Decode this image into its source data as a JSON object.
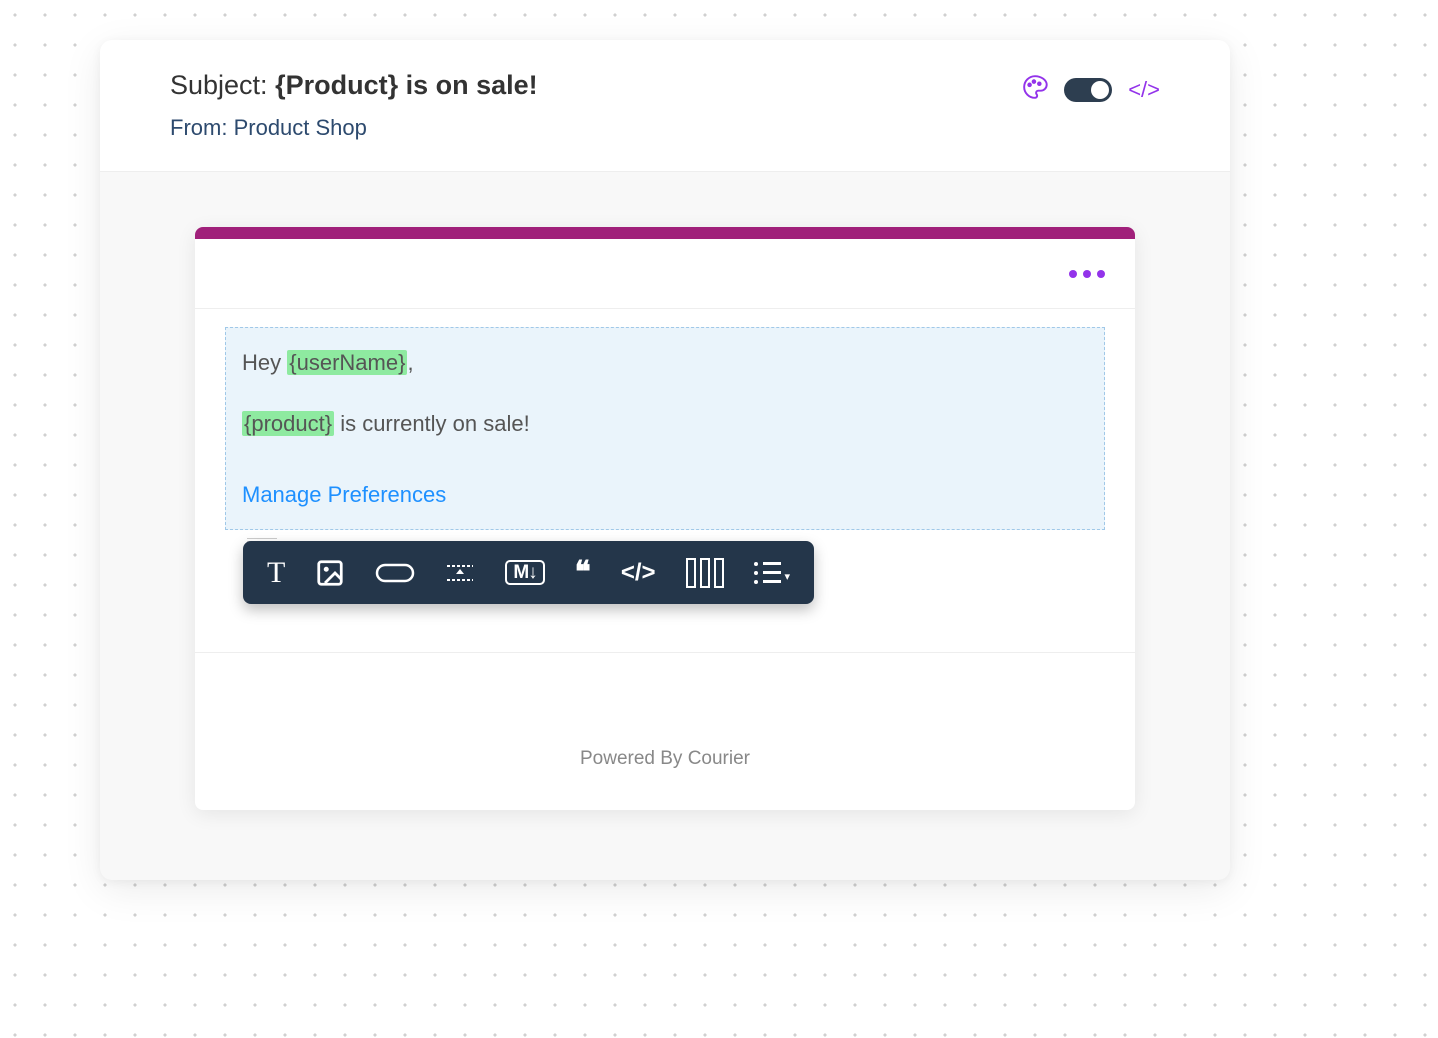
{
  "header": {
    "subject_label": "Subject:",
    "subject_value": "{Product} is on sale!",
    "from_label": "From:",
    "from_value": "Product Shop"
  },
  "email_body": {
    "greeting_prefix": "Hey ",
    "greeting_var": "{userName}",
    "greeting_suffix": ",",
    "line2_var": "{product}",
    "line2_rest": " is currently on sale!",
    "manage_link": "Manage Preferences"
  },
  "toolbar": {
    "text": "T",
    "markdown": "M↓",
    "quote": "❝",
    "code": "</>"
  },
  "footer": {
    "powered": "Powered By Courier"
  },
  "controls": {
    "code_toggle": "</>"
  }
}
